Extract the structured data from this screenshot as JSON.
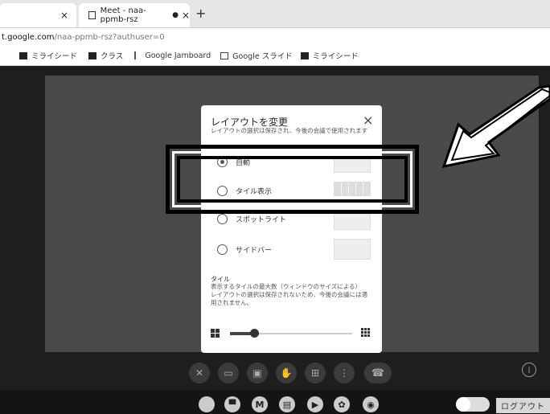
{
  "tabs": [
    {
      "label": "",
      "close": "×"
    },
    {
      "label": "Meet - naa-ppmb-rsz",
      "close": "×",
      "recording_dot": "●"
    }
  ],
  "new_tab": "+",
  "url": {
    "host": "t.google.com",
    "rest": "/naa-ppmb-rsz?authuser=0"
  },
  "bookmarks": [
    {
      "label": "ミライシード",
      "icon": "mail-icon"
    },
    {
      "label": "クラス",
      "icon": "classroom-icon"
    },
    {
      "label": "Google Jamboard",
      "icon": "jamboard-icon"
    },
    {
      "label": "Google スライド",
      "icon": "slides-icon"
    },
    {
      "label": "ミライシード",
      "icon": "mail-icon"
    }
  ],
  "dialog": {
    "title": "レイアウトを変更",
    "description": "レイアウトの選択は保存され、今後の会議で使用されます",
    "close": "×",
    "options": [
      {
        "label": "自動",
        "selected": true
      },
      {
        "label": "タイル表示",
        "selected": false
      },
      {
        "label": "スポットライト",
        "selected": false
      },
      {
        "label": "サイドバー",
        "selected": false
      }
    ],
    "tile_heading": "タイル",
    "tile_description": "表示するタイルの最大数（ウィンドウのサイズによる）\nレイアウトの選択は保存されないため、今後の会議には適用されません。",
    "slider_value": 0.2
  },
  "controls": [
    "mic-off-icon",
    "camera-icon",
    "captions-icon",
    "raise-hand-icon",
    "present-icon",
    "more-icon"
  ],
  "end_call_icon": "phone-hangup-icon",
  "info": "i",
  "shelf_apps": [
    {
      "name": "chrome-icon",
      "glyph": ""
    },
    {
      "name": "files-icon",
      "glyph": "▀"
    },
    {
      "name": "gmail-icon",
      "glyph": "M"
    },
    {
      "name": "docs-icon",
      "glyph": "▤"
    },
    {
      "name": "youtube-icon",
      "glyph": "▶"
    },
    {
      "name": "photos-icon",
      "glyph": "✿"
    },
    {
      "name": "camera-app-icon",
      "glyph": "◉"
    }
  ],
  "logout_label": "ログアウト",
  "colors": {
    "meet_bg": "#1e1e1e",
    "stage": "#4a4a4a",
    "dialog": "#ffffff"
  }
}
